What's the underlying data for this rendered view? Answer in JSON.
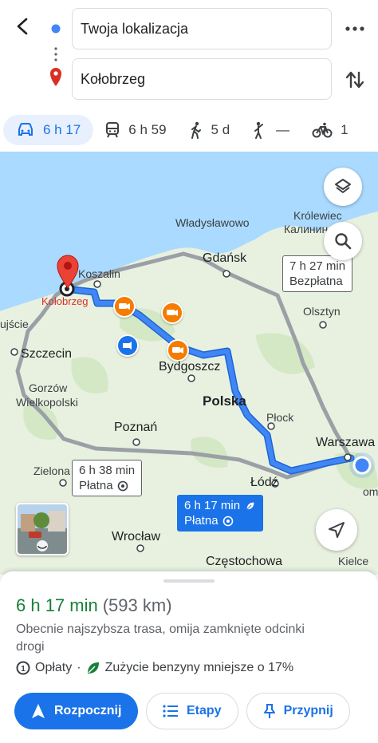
{
  "header": {
    "from": "Twoja lokalizacja",
    "to": "Kołobrzeg"
  },
  "modes": [
    {
      "icon": "car-icon",
      "label": "6 h 17",
      "active": true
    },
    {
      "icon": "train-icon",
      "label": "6 h 59"
    },
    {
      "icon": "walk-icon",
      "label": "5 d"
    },
    {
      "icon": "ride-hailing-icon",
      "label": "—"
    },
    {
      "icon": "bike-icon",
      "label": "1"
    }
  ],
  "map": {
    "labels": {
      "wladyslawowo": "Władysławowo",
      "krolewiec": "Królewiec",
      "kaliningrad": "Калинин",
      "gdansk": "Gdańsk",
      "koszalin": "Koszalin",
      "kolobrzeg": "Kołobrzeg",
      "ujscie": "ujście",
      "olsztyn": "Olsztyn",
      "szczecin": "Szczecin",
      "bydgoszcz": "Bydgoszcz",
      "polska": "Polska",
      "gorzow1": "Gorzów",
      "gorzow2": "Wielkopolski",
      "plock": "Płock",
      "poznan": "Poznań",
      "warszawa": "Warszawa",
      "zielona": "Zielona",
      "lodz": "Łódź",
      "om": "om",
      "wroclaw": "Wrocław",
      "czestochowa": "Częstochowa",
      "kielce": "Kielce"
    },
    "callouts": {
      "alt1_time": "7 h 27 min",
      "alt1_toll": "Bezpłatna",
      "alt2_time": "6 h 38 min",
      "alt2_toll": "Płatna",
      "main_time": "6 h 17 min",
      "main_toll": "Płatna"
    }
  },
  "sheet": {
    "time": "6 h 17 min",
    "distance": "(593 km)",
    "description": "Obecnie najszybsza trasa, omija zamknięte odcinki drogi",
    "tolls": "Opłaty",
    "separator": "·",
    "eco": "Zużycie benzyny mniejsze o 17%",
    "buttons": {
      "start": "Rozpocznij",
      "steps": "Etapy",
      "pin": "Przypnij"
    }
  },
  "colors": {
    "accent": "#1a73e8",
    "route": "#4285f4",
    "green": "#188038",
    "sea": "#aadaff",
    "land": "#e8f1e0"
  }
}
